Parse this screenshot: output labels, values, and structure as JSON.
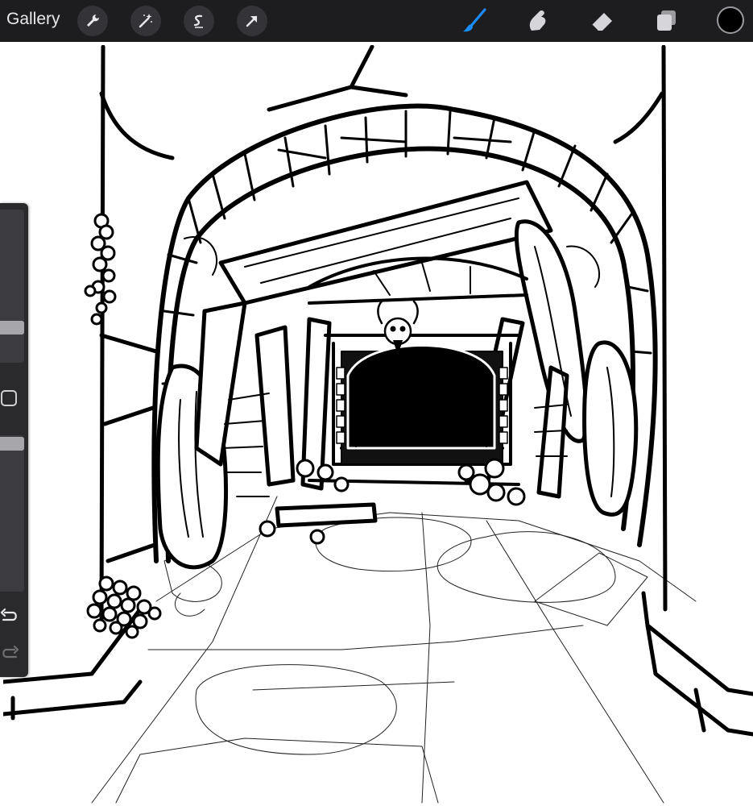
{
  "app": {
    "gallery_label": "Gallery"
  },
  "toolbar": {
    "left_tools": [
      "actions",
      "adjustments",
      "selection",
      "transform"
    ],
    "right_tools": [
      "brush",
      "smudge",
      "eraser",
      "layers",
      "color"
    ],
    "active_tool": "brush",
    "active_color": "#1a8cff",
    "current_color": "#000000"
  },
  "sidebar": {
    "brush_size_level": 0.5,
    "opacity_level": 1.0
  },
  "theme": {
    "toolbar_bg": "#1d1d1f",
    "sidebar_bg": "#2a2a2c",
    "ink": "#000000"
  }
}
